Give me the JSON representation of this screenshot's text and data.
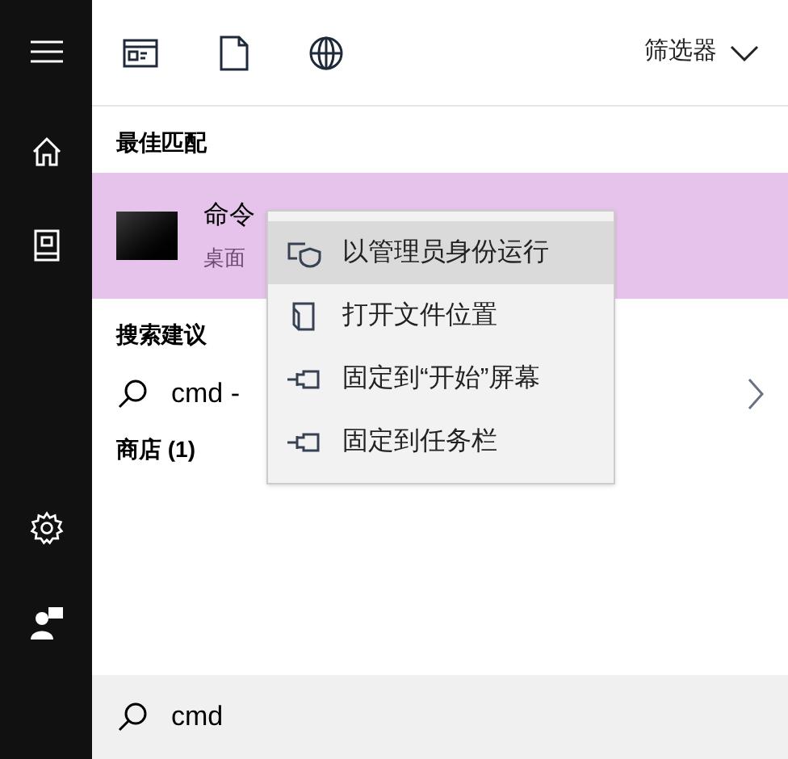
{
  "toolbar": {
    "filter": "筛选器"
  },
  "best_match": {
    "heading": "最佳匹配",
    "title": "命令",
    "subtitle": "桌面",
    "selected": true
  },
  "suggestions": {
    "heading": "搜索建议",
    "query": "cmd -"
  },
  "store": {
    "heading": "商店 (1)"
  },
  "context_menu": [
    {
      "kind": "shield",
      "label": "以管理员身份运行",
      "selected": true
    },
    {
      "kind": "folder",
      "label": "打开文件位置",
      "selected": false
    },
    {
      "kind": "pin",
      "label": "固定到“开始”屏幕",
      "selected": false
    },
    {
      "kind": "pin",
      "label": "固定到任务栏",
      "selected": false
    }
  ],
  "search_box": {
    "value": "cmd"
  }
}
